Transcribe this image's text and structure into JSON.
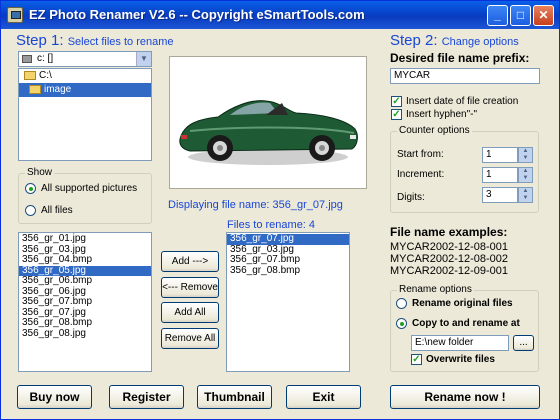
{
  "titlebar": {
    "title": "EZ Photo Renamer V2.6  -- Copyright eSmartTools.com",
    "minimize": "_",
    "maximize": "□",
    "close": "✕"
  },
  "step1": {
    "step_label": "Step 1:",
    "hint": "Select files to rename",
    "drive": "c: []",
    "folders": [
      {
        "label": "C:\\",
        "selected": false
      },
      {
        "label": "image",
        "selected": true
      }
    ],
    "show": {
      "title": "Show",
      "options": [
        "All supported pictures",
        "All files"
      ],
      "selected": 0
    },
    "files": [
      "356_gr_01.jpg",
      "356_gr_03.jpg",
      "356_gr_04.bmp",
      "356_gr_05.jpg",
      "356_gr_06.bmp",
      "356_gr_06.jpg",
      "356_gr_07.bmp",
      "356_gr_07.jpg",
      "356_gr_08.bmp",
      "356_gr_08.jpg"
    ],
    "files_selected": 3
  },
  "preview": {
    "caption": "Displaying file name: 356_gr_07.jpg"
  },
  "actions": {
    "add": "Add --->",
    "remove": "<--- Remove",
    "add_all": "Add All",
    "remove_all": "Remove All"
  },
  "rename_list": {
    "title": "Files to rename:  4",
    "files": [
      "356_gr_07.jpg",
      "356_gr_03.jpg",
      "356_gr_07.bmp",
      "356_gr_08.bmp"
    ],
    "selected": 0
  },
  "step2": {
    "step_label": "Step 2:",
    "hint": "Change options",
    "prefix_label": "Desired file name prefix:",
    "prefix_value": "MYCAR",
    "insert_date": "Insert date of file creation",
    "insert_hyphen": "Insert hyphen\"-\"",
    "counter": {
      "title": "Counter options",
      "start_label": "Start from:",
      "start_value": "1",
      "increment_label": "Increment:",
      "increment_value": "1",
      "digits_label": "Digits:",
      "digits_value": "3"
    },
    "examples_label": "File name examples:",
    "examples": [
      "MYCAR2002-12-08-001",
      "MYCAR2002-12-08-002",
      "MYCAR2002-12-09-001"
    ],
    "rename_options": {
      "title": "Rename options",
      "opt_original": "Rename original files",
      "opt_copy": "Copy to and rename at",
      "selected": 1,
      "path": "E:\\new folder",
      "browse": "...",
      "overwrite": "Overwrite files"
    }
  },
  "bottom": {
    "buy": "Buy now",
    "register": "Register",
    "thumbnail": "Thumbnail",
    "exit": "Exit",
    "rename": "Rename now !"
  },
  "colors": {
    "accent_blue": "#1946d6",
    "selection": "#316ac5",
    "titlebar": "#0a5fe8",
    "window_bg": "#ece9d8",
    "car_green": "#1e5a34"
  }
}
